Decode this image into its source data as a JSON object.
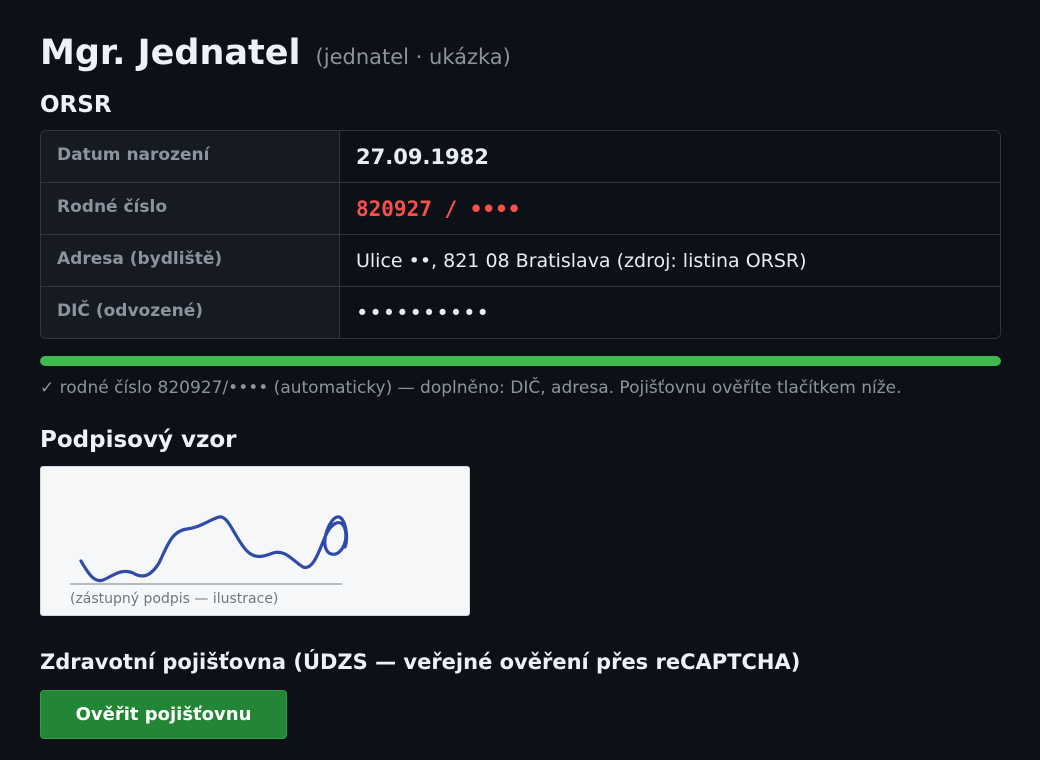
{
  "header": {
    "name": "Mgr. Jednatel",
    "role": "(jednatel · ukázka)"
  },
  "orsr": {
    "title": "ORSR",
    "rows": [
      {
        "label": "Datum narození",
        "value": "27.09.1982"
      },
      {
        "label": "Rodné číslo",
        "value": "820927 / ••••"
      },
      {
        "label": "Adresa (bydliště)",
        "value": "Ulice ••, 821 08 Bratislava (zdroj: listina ORSR)"
      },
      {
        "label": "DIČ (odvozené)",
        "value": "••••••••••"
      }
    ]
  },
  "progress": {
    "percent": 100,
    "color": "#3fb950"
  },
  "status_text": "✓ rodné číslo 820927/•••• (automaticky) — doplněno: DIČ, adresa. Pojišťovnu ověříte tlačítkem níže.",
  "signature": {
    "title": "Podpisový vzor",
    "caption": "(zástupný podpis — ilustrace)"
  },
  "insurance": {
    "title": "Zdravotní pojišťovna (ÚDZS — veřejné ověření přes reCAPTCHA)",
    "button_label": "Ověřit pojišťovnu"
  },
  "colors": {
    "background": "#0d1117",
    "accent_red": "#f85149",
    "button": "#238636"
  }
}
